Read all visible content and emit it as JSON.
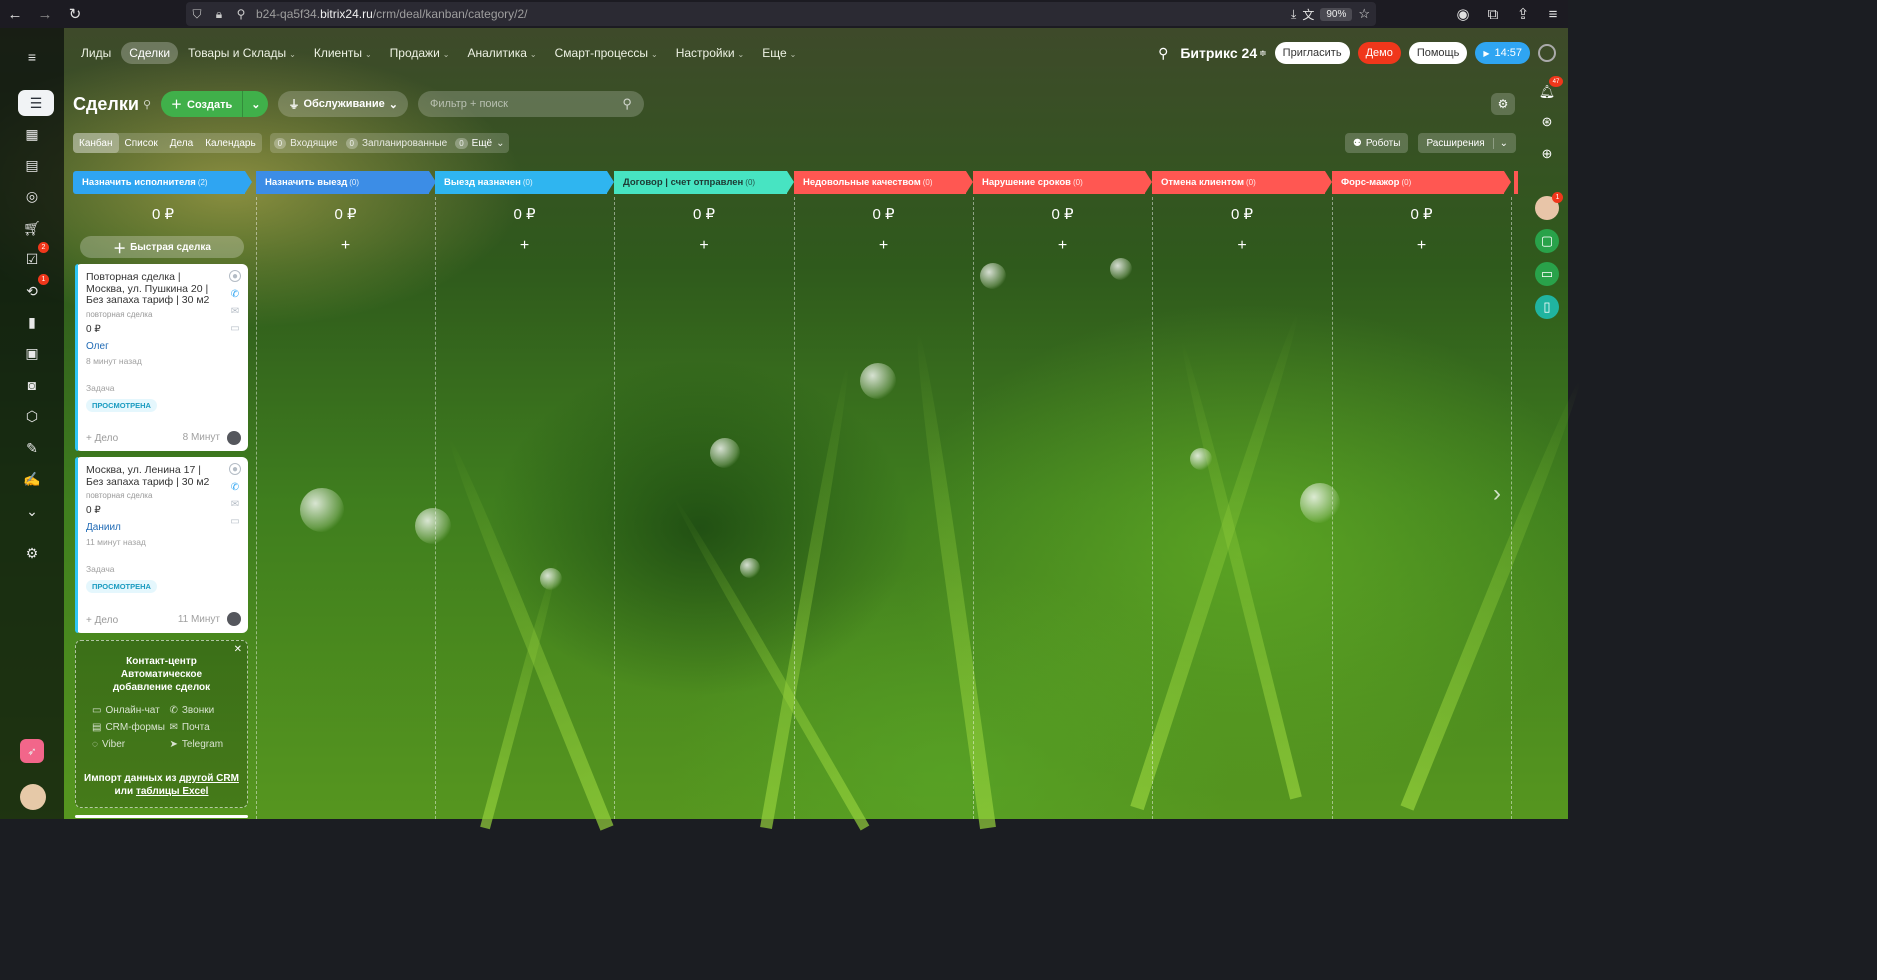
{
  "browser": {
    "url_host": "b24-qa5f34.bitrix24.ru",
    "url_pre": "b24-qa5f34.",
    "url_domain": "bitrix24.ru",
    "url_path": "/crm/deal/kanban/category/2/",
    "zoom": "90%"
  },
  "nav": {
    "items": [
      {
        "label": "Лиды",
        "arrow": ""
      },
      {
        "label": "Сделки",
        "arrow": ""
      },
      {
        "label": "Товары и Склады",
        "arrow": "⌄"
      },
      {
        "label": "Клиенты",
        "arrow": "⌄"
      },
      {
        "label": "Продажи",
        "arrow": "⌄"
      },
      {
        "label": "Аналитика",
        "arrow": "⌄"
      },
      {
        "label": "Смарт-процессы",
        "arrow": "⌄"
      },
      {
        "label": "Настройки",
        "arrow": "⌄"
      },
      {
        "label": "Еще",
        "arrow": "⌄"
      }
    ]
  },
  "header": {
    "logo": "Битрикс 24",
    "invite": "Пригласить",
    "demo": "Демо",
    "help": "Помощь",
    "time": "14:57",
    "notify_count": "47",
    "chat_count": "1"
  },
  "sidebar": {
    "badge_tasks": "2",
    "badge_processes": "1"
  },
  "page": {
    "title": "Сделки",
    "create": "Создать",
    "pipeline": "Обслуживание",
    "filter_placeholder": "Фильтр + поиск"
  },
  "views": {
    "tabs": [
      "Канбан",
      "Список",
      "Дела",
      "Календарь"
    ],
    "counters": [
      {
        "n": "0",
        "label": "Входящие"
      },
      {
        "n": "0",
        "label": "Запланированные"
      },
      {
        "n": "0",
        "label": "Ещё"
      }
    ],
    "robots": "Роботы",
    "extensions": "Расширения"
  },
  "kanban": {
    "quick_deal": "Быстрая сделка",
    "columns": [
      {
        "name": "Назначить исполнителя",
        "count": "(2)",
        "sum": "0 ₽",
        "color": "#2fa5f2"
      },
      {
        "name": "Назначить выезд",
        "count": "(0)",
        "sum": "0 ₽",
        "color": "#3c8de6"
      },
      {
        "name": "Выезд назначен",
        "count": "(0)",
        "sum": "0 ₽",
        "color": "#2fb5f0"
      },
      {
        "name": "Договор | счет отправлен",
        "count": "(0)",
        "sum": "0 ₽",
        "color": "#47e4c2"
      },
      {
        "name": "Недовольные качеством",
        "count": "(0)",
        "sum": "0 ₽",
        "color": "#ff5752"
      },
      {
        "name": "Нарушение сроков",
        "count": "(0)",
        "sum": "0 ₽",
        "color": "#ff5752"
      },
      {
        "name": "Отмена клиентом",
        "count": "(0)",
        "sum": "0 ₽",
        "color": "#ff5752"
      },
      {
        "name": "Форс-мажор",
        "count": "(0)",
        "sum": "0 ₽",
        "color": "#ff5752"
      }
    ],
    "cards": [
      {
        "title": "Повторная сделка | Москва, ул. Пушкина 20 | Без запаха тариф | 30 м2",
        "kind": "повторная сделка",
        "amount": "0 ₽",
        "person": "Олег",
        "time": "8 минут назад",
        "task_label": "Задача",
        "tag": "ПРОСМОТРЕНА",
        "add": "+ Дело",
        "ago": "8 Минут"
      },
      {
        "title": "Москва, ул. Ленина 17 | Без запаха тариф | 30 м2",
        "kind": "повторная сделка",
        "amount": "0 ₽",
        "person": "Даниил",
        "time": "11 минут назад",
        "task_label": "Задача",
        "tag": "ПРОСМОТРЕНА",
        "add": "+ Дело",
        "ago": "11 Минут"
      }
    ],
    "contact_center": {
      "heading": "Контакт-центр Автоматическое добавление сделок",
      "channels": [
        "Онлайн-чат",
        "Звонки",
        "CRM-формы",
        "Почта",
        "Viber",
        "Telegram"
      ],
      "import_pre": "Импорт данных из ",
      "import_link1": "другой CRM",
      "import_mid": " или ",
      "import_link2": "таблицы Excel"
    }
  }
}
